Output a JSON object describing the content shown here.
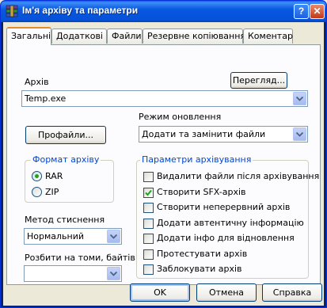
{
  "window": {
    "title": "Ім'я архіву та параметри",
    "help_label": "?",
    "close_label": "✕"
  },
  "tabs": [
    {
      "label": "Загальні",
      "active": true
    },
    {
      "label": "Додаткові",
      "active": false
    },
    {
      "label": "Файли",
      "active": false
    },
    {
      "label": "Резервне копіювання",
      "active": false
    },
    {
      "label": "Коментар",
      "active": false
    }
  ],
  "archive": {
    "label": "Архів",
    "value": "Temp.exe",
    "browse_label": "Перегляд..."
  },
  "profiles_label": "Профайли...",
  "update_mode": {
    "label": "Режим оновлення",
    "value": "Додати та замінити файли"
  },
  "format": {
    "title": "Формат архіву",
    "options": [
      {
        "label": "RAR",
        "selected": true
      },
      {
        "label": "ZIP",
        "selected": false
      }
    ]
  },
  "compression": {
    "label": "Метод стиснення",
    "value": "Нормальний"
  },
  "split": {
    "label": "Розбити на томи, байтів",
    "value": ""
  },
  "archiving_options": {
    "title": "Параметри архівування",
    "items": [
      {
        "label": "Видалити файли після архівування",
        "checked": false
      },
      {
        "label": "Створити SFX-архів",
        "checked": true
      },
      {
        "label": "Створити неперервний архів",
        "checked": false
      },
      {
        "label": "Додати автентичну інформацію",
        "checked": false
      },
      {
        "label": "Додати інфо для відновлення",
        "checked": false
      },
      {
        "label": "Протестувати архів",
        "checked": false
      },
      {
        "label": "Заблокувати архів",
        "checked": false
      }
    ]
  },
  "buttons": {
    "ok": "OK",
    "cancel": "Отмена",
    "help": "Справка"
  },
  "colors": {
    "accent": "#0046d5",
    "check_mark": "#21a121",
    "title_bar": "#0858e3"
  }
}
